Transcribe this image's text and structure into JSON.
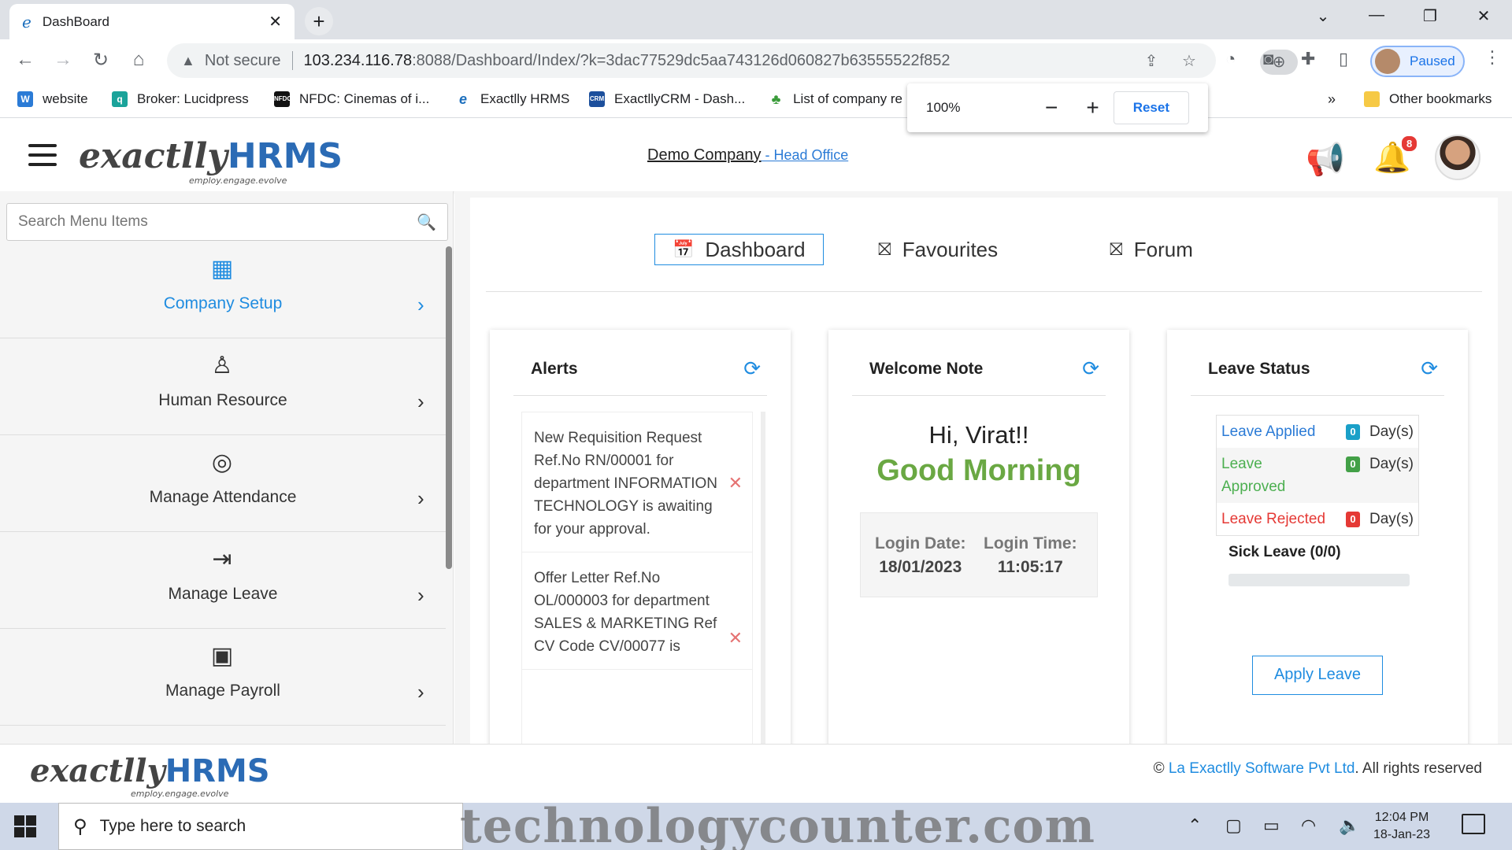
{
  "browser": {
    "tab_title": "DashBoard",
    "omnibox": {
      "security_label": "Not secure",
      "url_host": "103.234.116.78",
      "url_rest": ":8088/Dashboard/Index/?k=3dac77529dc5aa743126d060827b63555522f852"
    },
    "profile_label": "Paused",
    "bookmarks": [
      {
        "label": "website",
        "icon": "w-icon",
        "color": "#2b7bd6"
      },
      {
        "label": "Broker: Lucidpress",
        "icon": "lucidpress-icon",
        "color": "#1aa39a"
      },
      {
        "label": "NFDC: Cinemas of i...",
        "icon": "nfdc-icon",
        "color": "#111111"
      },
      {
        "label": "Exactlly HRMS",
        "icon": "exactlly-icon",
        "color": "#1c6fbd"
      },
      {
        "label": "ExactllyCRM - Dash...",
        "icon": "crm-icon",
        "color": "#1c4f9c"
      },
      {
        "label": "List of company re",
        "icon": "plant-icon",
        "color": "#3a9b3a"
      }
    ],
    "other_bookmarks": "Other bookmarks",
    "zoom_popup": {
      "value": "100%",
      "reset_label": "Reset"
    }
  },
  "header": {
    "logo_main": "exactlly",
    "logo_brand": "HRMS",
    "logo_tagline": "employ.engage.evolve",
    "company_name": "Demo Company",
    "branch": " - Head Office",
    "notification_count": "8"
  },
  "sidebar": {
    "search_placeholder": "Search Menu Items",
    "items": [
      {
        "label": "Company Setup",
        "icon": "building-icon",
        "active": true
      },
      {
        "label": "Human Resource",
        "icon": "person-icon",
        "active": false
      },
      {
        "label": "Manage Attendance",
        "icon": "target-icon",
        "active": false
      },
      {
        "label": "Manage Leave",
        "icon": "exit-icon",
        "active": false
      },
      {
        "label": "Manage Payroll",
        "icon": "payroll-icon",
        "active": false
      }
    ]
  },
  "main": {
    "tabs": [
      {
        "label": "Dashboard",
        "icon": "calendar-icon",
        "active": true
      },
      {
        "label": "Favourites",
        "icon": "star-box-icon",
        "active": false
      },
      {
        "label": "Forum",
        "icon": "star-box-icon",
        "active": false
      }
    ],
    "alerts": {
      "title": "Alerts",
      "items": [
        "New Requisition Request Ref.No RN/00001 for department INFORMATION TECHNOLOGY is awaiting for your approval.",
        "Offer Letter Ref.No OL/000003 for department SALES & MARKETING Ref CV Code CV/00077 is"
      ]
    },
    "welcome": {
      "title": "Welcome Note",
      "greeting": "Hi, Virat!!",
      "salutation": "Good Morning",
      "login_date_label": "Login Date:",
      "login_date": "18/01/2023",
      "login_time_label": "Login Time:",
      "login_time": "11:05:17"
    },
    "leave": {
      "title": "Leave Status",
      "rows": [
        {
          "label": "Leave Applied",
          "count": "0",
          "unit": "Day(s)",
          "color": "#2b7bd6",
          "badge": "#1aa0c8"
        },
        {
          "label": "Leave Approved",
          "count": "0",
          "unit": "Day(s)",
          "color": "#4caf50",
          "badge": "#43a047"
        },
        {
          "label": "Leave Rejected",
          "count": "0",
          "unit": "Day(s)",
          "color": "#e53935",
          "badge": "#e53935"
        }
      ],
      "sick_leave": "Sick Leave (0/0)",
      "sick_leave_progress": 0,
      "apply_label": "Apply Leave"
    }
  },
  "footer": {
    "copyright_symbol": "©",
    "company": "La Exactlly Software Pvt Ltd",
    "rights": ". All rights reserved"
  },
  "taskbar": {
    "search_placeholder": "Type here to search",
    "watermark": "technologycounter.com",
    "time": "12:04 PM",
    "date": "18-Jan-23"
  }
}
